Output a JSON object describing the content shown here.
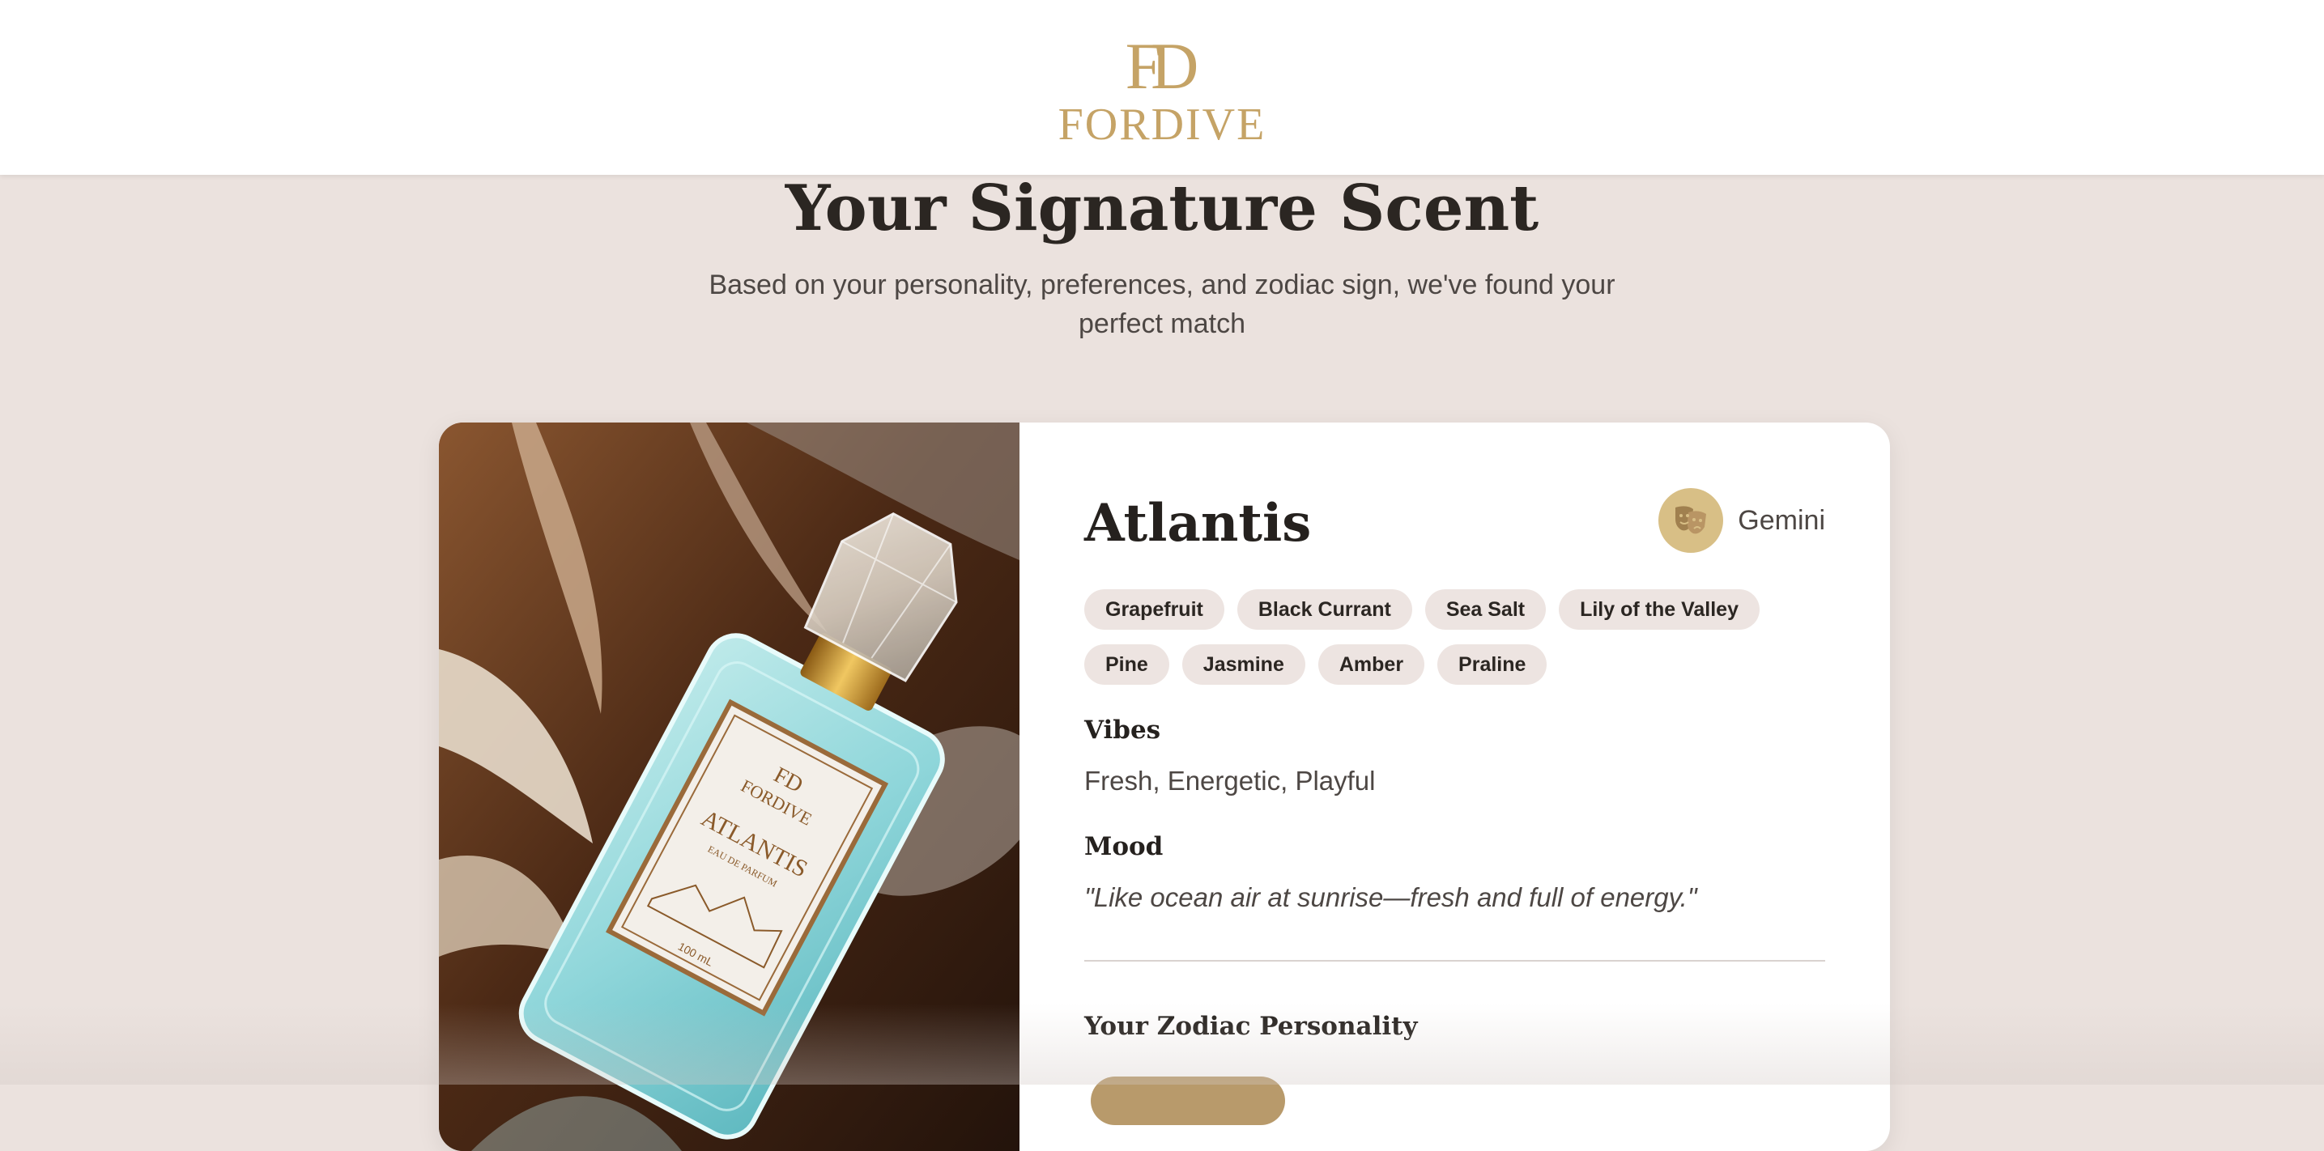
{
  "header": {
    "logo_mark": "FD",
    "logo_text": "FORDIVE"
  },
  "hero": {
    "title": "Your Signature Scent",
    "subtitle": "Based on your personality, preferences, and zodiac sign, we've found your perfect match"
  },
  "result": {
    "image_alt": "Atlantis eau de parfum bottle",
    "bottle_label": {
      "brand_mark": "FD",
      "brand": "FORDIVE",
      "name": "ATLANTIS",
      "type": "EAU DE PARFUM",
      "volume": "100 mL"
    },
    "name": "Atlantis",
    "zodiac": {
      "icon": "theater-masks-icon",
      "label": "Gemini"
    },
    "notes": [
      "Grapefruit",
      "Black Currant",
      "Sea Salt",
      "Lily of the Valley",
      "Pine",
      "Jasmine",
      "Amber",
      "Praline"
    ],
    "vibes_label": "Vibes",
    "vibes": "Fresh, Energetic, Playful",
    "mood_label": "Mood",
    "mood": "\"Like ocean air at sunrise—fresh and full of energy.\"",
    "zodiac_personality_label": "Your Zodiac Personality"
  },
  "colors": {
    "background": "#ebe2de",
    "brand_gold": "#c5a366",
    "zodiac_badge": "#d8bf86",
    "tag_background": "#ede4e1",
    "button": "#b89a6b"
  }
}
